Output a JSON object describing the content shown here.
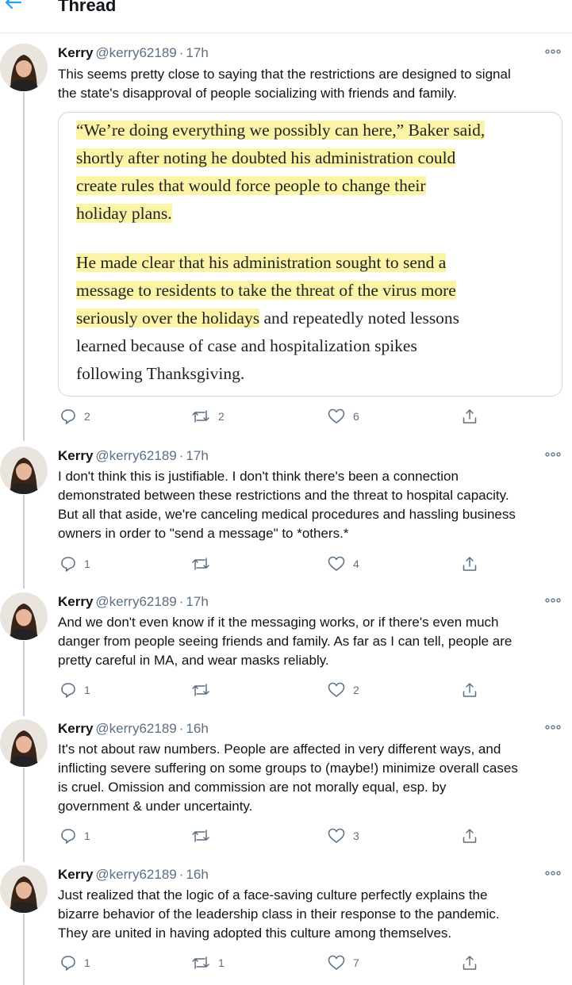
{
  "header": {
    "title": "Thread"
  },
  "tweets": [
    {
      "name": "Kerry",
      "handle": "@kerry62189",
      "sep": "·",
      "time": "17h",
      "lines": [
        "This seems pretty close to saying that the restrictions are designed to signal",
        "the state's disapproval of people socializing with friends and family."
      ],
      "quote": {
        "p1": [
          "“We’re doing everything we possibly can here,” Baker said,",
          "shortly after noting he doubted his administration could",
          "create rules that would force people to change their",
          "holiday plans."
        ],
        "p2": [
          "He made clear that his administration sought to send a",
          "message to residents to take the threat of the virus more",
          "seriously over the holidays"
        ],
        "p2_rest": " and repeatedly noted lessons",
        "p3": [
          "learned because of case and hospitalization spikes",
          "following Thanksgiving."
        ]
      },
      "replies": "2",
      "retweets": "2",
      "likes": "6"
    },
    {
      "name": "Kerry",
      "handle": "@kerry62189",
      "sep": "·",
      "time": "17h",
      "lines": [
        "I don't think this is justifiable. I don't think there's been a connection",
        "demonstrated between these restrictions and the threat to hospital capacity.",
        "But all that aside, we're canceling medical procedures and hassling business",
        "owners in order to \"send a message\" to *others.*"
      ],
      "replies": "1",
      "retweets": "",
      "likes": "4"
    },
    {
      "name": "Kerry",
      "handle": "@kerry62189",
      "sep": "·",
      "time": "17h",
      "lines": [
        "And we don't even know if it the messaging works, or if there's even much",
        "danger from people seeing friends and family. As far as I can tell, people are",
        "pretty careful in MA, and wear masks reliably."
      ],
      "replies": "1",
      "retweets": "",
      "likes": "2"
    },
    {
      "name": "Kerry",
      "handle": "@kerry62189",
      "sep": "·",
      "time": "16h",
      "lines": [
        "It's not about raw numbers. People are affected in very different ways, and",
        "inflicting severe suffering on some groups to (maybe!) minimize overall cases",
        "is cruel. Omission and commission are not morally equal, esp. by",
        "government & under uncertainty."
      ],
      "replies": "1",
      "retweets": "",
      "likes": "3"
    },
    {
      "name": "Kerry",
      "handle": "@kerry62189",
      "sep": "·",
      "time": "16h",
      "lines": [
        "Just realized that the logic of a face-saving culture perfectly explains the",
        "bizarre behavior of the leadership class in their response to the pandemic.",
        "They are united in having adopted this culture among themselves."
      ],
      "replies": "1",
      "retweets": "1",
      "likes": "7"
    }
  ],
  "icons": {
    "back": "back-arrow-icon",
    "more": "more-icon",
    "reply": "reply-icon",
    "retweet": "retweet-icon",
    "like": "like-icon",
    "share": "share-icon"
  },
  "colors": {
    "accent": "#1da1f2",
    "muted": "#5b7083",
    "highlight": "#fbf3a6"
  }
}
